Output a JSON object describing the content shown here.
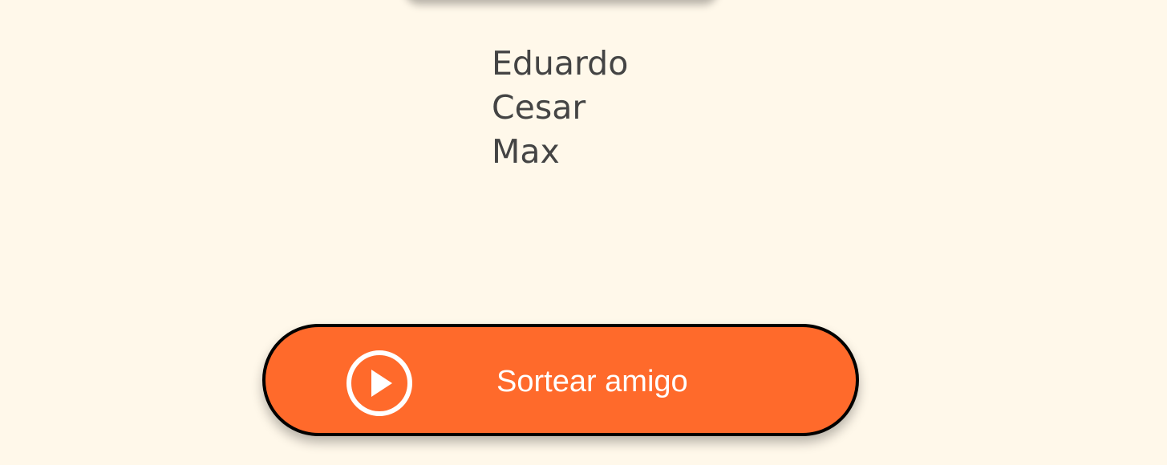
{
  "friends": {
    "items": [
      {
        "name": "Eduardo"
      },
      {
        "name": "Cesar"
      },
      {
        "name": "Max"
      }
    ]
  },
  "draw_button": {
    "label": "Sortear amigo",
    "icon": "play-circle-icon"
  },
  "colors": {
    "background": "#FFF8EA",
    "button": "#FF6A2B",
    "button_border": "#000000",
    "list_text": "#444444",
    "button_text": "#FFFFFF"
  }
}
